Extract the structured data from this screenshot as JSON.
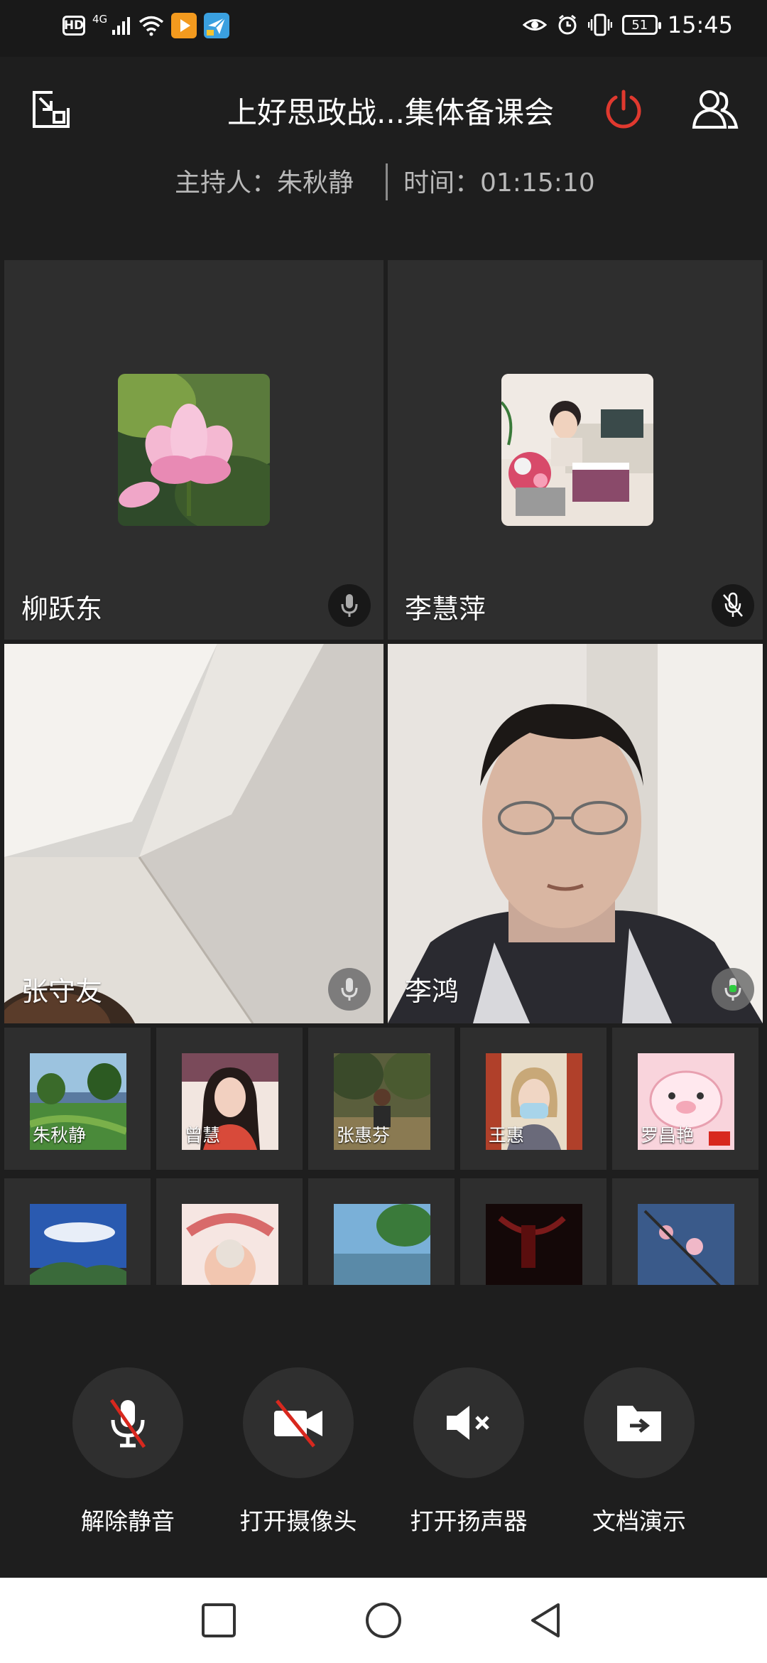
{
  "status_bar": {
    "hd": "HD",
    "network": "4G",
    "time": "15:45",
    "battery": "51",
    "icons": [
      "hd-icon",
      "signal-icon",
      "wifi-icon",
      "app-play-icon",
      "app-send-icon",
      "eye-icon",
      "alarm-icon",
      "vibrate-icon",
      "battery-icon"
    ]
  },
  "header": {
    "title": "上好思政战...集体备课会",
    "host": "主持人：朱秋静",
    "duration": "时间：01:15:10",
    "icons": [
      "minimize-window-icon",
      "power-icon",
      "participants-icon"
    ]
  },
  "main_tiles": [
    {
      "name": "柳跃东",
      "mic": "available"
    },
    {
      "name": "李慧萍",
      "mic": "muted"
    },
    {
      "name": "张守友",
      "mic": "available"
    },
    {
      "name": "李鸿",
      "mic": "speaking"
    }
  ],
  "thumbnail_rows": [
    [
      {
        "name": "朱秋静"
      },
      {
        "name": "曾慧"
      },
      {
        "name": "张惠芬"
      },
      {
        "name": "王惠"
      },
      {
        "name": "罗昌艳"
      }
    ],
    [
      {
        "name": ""
      },
      {
        "name": ""
      },
      {
        "name": ""
      },
      {
        "name": ""
      },
      {
        "name": ""
      }
    ]
  ],
  "controls": [
    {
      "label": "解除静音",
      "icon": "mic-off-icon"
    },
    {
      "label": "打开摄像头",
      "icon": "camera-off-icon"
    },
    {
      "label": "打开扬声器",
      "icon": "speaker-off-icon"
    },
    {
      "label": "文档演示",
      "icon": "share-document-icon"
    }
  ],
  "nav_bar": {
    "icons": [
      "recents-icon",
      "home-icon",
      "back-icon"
    ]
  },
  "colors": {
    "background": "#1e1e1e",
    "tile": "#2e2e2e",
    "power": "#e0392f",
    "speaking": "#2ecc40"
  }
}
